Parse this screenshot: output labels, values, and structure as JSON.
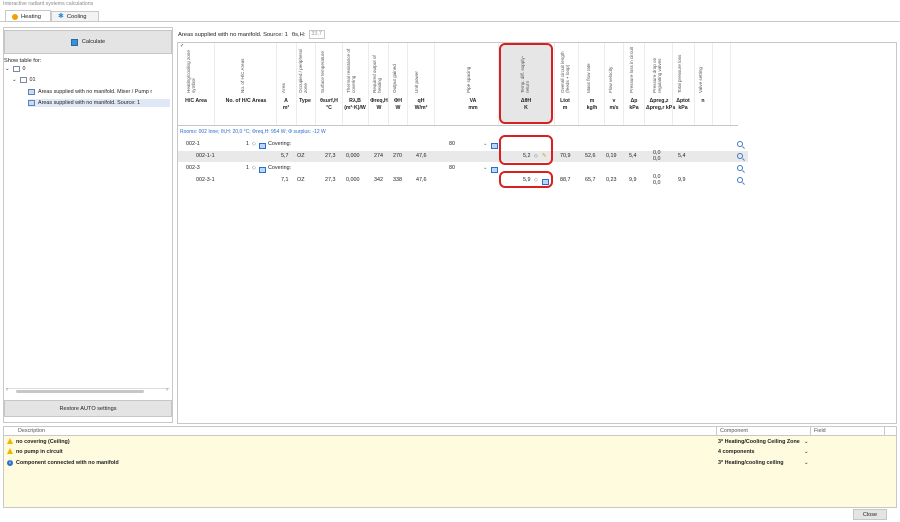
{
  "app_title": "Interactive radiant systems calculations",
  "tabs": [
    {
      "label": "Heating",
      "icon": "sun-icon"
    },
    {
      "label": "Cooling",
      "icon": "snowflake-icon"
    }
  ],
  "left": {
    "calculate_label": "Calculate",
    "show_table_for": "Show table for:",
    "tree": [
      {
        "label": "0",
        "level": 0
      },
      {
        "label": "01",
        "level": 1
      },
      {
        "label": "Areas supplied with no manifold. Mixer / Pump r",
        "level": 2
      },
      {
        "label": "Areas supplied with no manifold. Source: 1",
        "level": 2,
        "selected": true
      }
    ],
    "restore_label": "Restore AUTO settings"
  },
  "main": {
    "title": "Areas supplied with no manifold. Source: 1",
    "theta_label": "θs,H:",
    "theta_value": "33,7",
    "headers": [
      {
        "top": "Heating/cooling zone symbol",
        "sym": "H/C Area",
        "unit": ""
      },
      {
        "top": "No. of H/C Areas",
        "sym": "No. of H/C Areas",
        "unit": ""
      },
      {
        "top": "Area",
        "sym": "A",
        "unit": "m²"
      },
      {
        "top": "Occupied / peripheral zone",
        "sym": "Type",
        "unit": ""
      },
      {
        "top": "Surface temperature",
        "sym": "θsurf,H",
        "unit": "°C"
      },
      {
        "top": "Thermal resistance of covering",
        "sym": "Rλ,B",
        "unit": "(m²·K)/W"
      },
      {
        "top": "Required output of heating",
        "sym": "Φreq,H",
        "unit": "W"
      },
      {
        "top": "Output gained",
        "sym": "ΦH",
        "unit": "W"
      },
      {
        "top": "Unit power",
        "sym": "qH",
        "unit": "W/m²"
      },
      {
        "top": "Pipe spacing",
        "sym": "VA",
        "unit": "mm"
      },
      {
        "top": "Temp. diff. supply-return",
        "sym": "ΔθH",
        "unit": "K"
      },
      {
        "top": "Overall circuit length (feeds + loop)",
        "sym": "Ltot",
        "unit": "m"
      },
      {
        "top": "Mass flow rate",
        "sym": "m",
        "unit": "kg/h"
      },
      {
        "top": "Flow velocity",
        "sym": "v",
        "unit": "m/s"
      },
      {
        "top": "Pressure loss in circuit",
        "sym": "Δp",
        "unit": "kPa"
      },
      {
        "top": "Pressure drop on regulating valves",
        "sym": "Δpreg,z",
        "unit": "Δpreg,r kPa"
      },
      {
        "top": "Total pressure loss",
        "sym": "Δptot",
        "unit": "kPa"
      },
      {
        "top": "Valve setting",
        "sym": "n",
        "unit": ""
      }
    ],
    "room_line": "Rooms: 002 Inne; θi,H: 20,0 °C; Φreq,H: 954 W; Φ surplus: -12 W",
    "rows": [
      {
        "zone": "002-1",
        "count": "1",
        "covering": "Covering:",
        "spacing": "80"
      },
      {
        "zone": "002-1-1",
        "area": "5,7",
        "type": "OZ",
        "surf": "27,3",
        "rlb": "0,000",
        "req": "274",
        "out": "270",
        "unit": "47,6",
        "dtheta": "5,2",
        "ltot": "70,9",
        "mass": "52,6",
        "vel": "0,19",
        "dp": "5,4",
        "dpreg1": "0,0",
        "dpreg2": "0,0",
        "dptot": "5,4"
      },
      {
        "zone": "002-3",
        "count": "1",
        "covering": "Covering:",
        "spacing": "80"
      },
      {
        "zone": "002-3-1",
        "area": "7,1",
        "type": "OZ",
        "surf": "27,3",
        "rlb": "0,000",
        "req": "342",
        "out": "338",
        "unit": "47,6",
        "dtheta": "5,9",
        "ltot": "88,7",
        "mass": "65,7",
        "vel": "0,23",
        "dp": "9,9",
        "dpreg1": "0,0",
        "dpreg2": "0,0",
        "dptot": "9,9"
      }
    ]
  },
  "messages": {
    "headers": {
      "description": "Description",
      "component": "Component",
      "field": "Field"
    },
    "items": [
      {
        "icon": "warning-icon",
        "text": "no covering (Ceiling)",
        "component": "3* Heating/Cooling Ceiling Zone"
      },
      {
        "icon": "warning-icon",
        "text": "no pump in circuit",
        "component": "4 components"
      },
      {
        "icon": "info-icon",
        "text": "Component connected with no manifold",
        "component": "3* Heating/cooling ceiling"
      }
    ]
  },
  "close_label": "Close",
  "colors": {
    "highlight": "#d92020",
    "accent": "#2b6fd1",
    "message_bg": "#fffbdf"
  }
}
